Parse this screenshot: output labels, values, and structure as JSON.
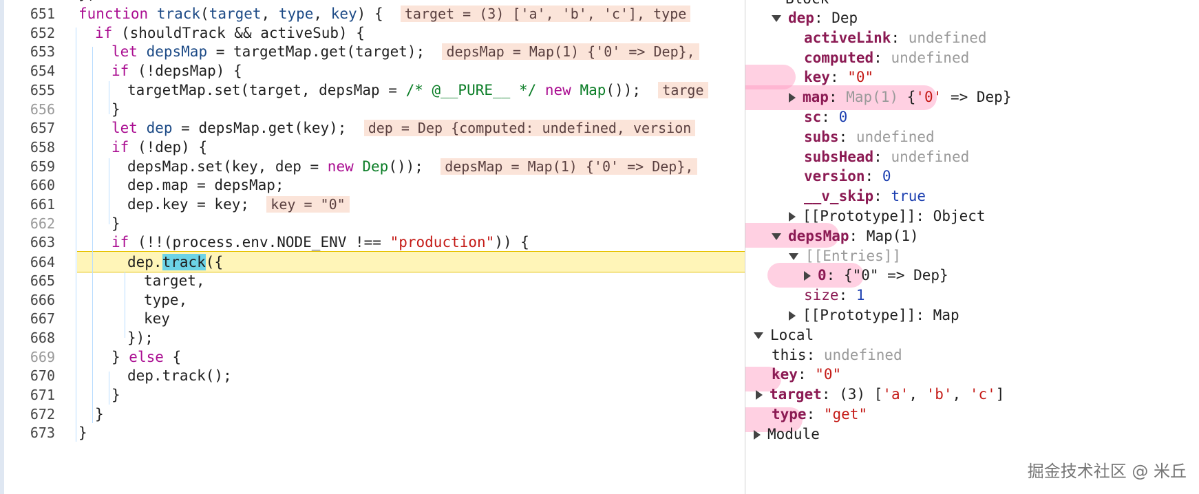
{
  "editor": {
    "partial_top_code": "};",
    "lines": [
      {
        "n": "651",
        "html": "<span class='kw'>function</span> <span class='fn'>track</span>(<span class='fn'>target</span>, <span class='fn'>type</span>, <span class='fn'>key</span>) {  <span class='inline-val'>target = (3) ['a', 'b', 'c'], type</span>",
        "indent": 114
      },
      {
        "n": "652",
        "html": "<span class='kw'>if</span> (shouldTrack && activeSub) {",
        "indent": 138
      },
      {
        "n": "653",
        "html": "<span class='kw'>let</span> <span class='fn'>depsMap</span> = targetMap.get(target);  <span class='inline-val'>depsMap = Map(1) {'0' => Dep},</span>",
        "indent": 162
      },
      {
        "n": "654",
        "html": "<span class='kw'>if</span> (!depsMap) {",
        "indent": 162
      },
      {
        "n": "655",
        "html": "targetMap.set(target, depsMap = <span class='cmt'>/* @__PURE__ */</span> <span class='kw'>new</span> <span class='cls'>Map</span>());  <span class='inline-val'>targe</span>",
        "indent": 185
      },
      {
        "n": "656",
        "html": "}",
        "indent": 162
      },
      {
        "n": "657",
        "html": "<span class='kw'>let</span> <span class='fn'>dep</span> = depsMap.get(key);  <span class='inline-val'>dep = Dep {computed: undefined, version</span>",
        "indent": 162
      },
      {
        "n": "658",
        "html": "<span class='kw'>if</span> (!dep) {",
        "indent": 162
      },
      {
        "n": "659",
        "html": "depsMap.set(key, dep = <span class='kw'>new</span> <span class='cls'>Dep</span>());  <span class='inline-val'>depsMap = Map(1) {'0' => Dep},</span>",
        "indent": 185
      },
      {
        "n": "660",
        "html": "dep.map = depsMap;",
        "indent": 185
      },
      {
        "n": "661",
        "html": "dep.key = key;  <span class='inline-val'>key = \"0\"</span>",
        "indent": 185
      },
      {
        "n": "662",
        "html": "}",
        "indent": 162
      },
      {
        "n": "663",
        "html": "<span class='kw'>if</span> (!!(process.env.NODE_ENV !== <span class='str'>\"production\"</span>)) {",
        "indent": 162
      },
      {
        "n": "664",
        "html": "dep.<span class='hl-track'>track</span>({",
        "indent": 185,
        "current": true
      },
      {
        "n": "665",
        "html": "target,",
        "indent": 209
      },
      {
        "n": "666",
        "html": "type,",
        "indent": 209
      },
      {
        "n": "667",
        "html": "key",
        "indent": 209
      },
      {
        "n": "668",
        "html": "});",
        "indent": 185
      },
      {
        "n": "669",
        "html": "} <span class='kw'>else</span> {",
        "indent": 162
      },
      {
        "n": "670",
        "html": "dep.track();",
        "indent": 185
      },
      {
        "n": "671",
        "html": "}",
        "indent": 162
      },
      {
        "n": "672",
        "html": "}",
        "indent": 138
      },
      {
        "n": "673",
        "html": "}",
        "indent": 114
      }
    ]
  },
  "scope": {
    "partial_top": "Block",
    "rows": [
      {
        "indent": 38,
        "tri": "down",
        "html": "<span class='pk'>dep</span>: <span class='plain'>Dep</span>"
      },
      {
        "indent": 85,
        "tri": "",
        "html": "<span class='pk'>activeLink</span>: <span class='und'>undefined</span>"
      },
      {
        "indent": 85,
        "tri": "",
        "html": "<span class='pk'>computed</span>: <span class='und'>undefined</span>"
      },
      {
        "indent": 85,
        "tri": "",
        "html": "<span class='pk'>key</span>: <span class='sstr'>\"0\"</span>",
        "mark": [
          1055,
          112,
          100
        ]
      },
      {
        "indent": 63,
        "tri": "right",
        "html": "<span class='pk'>map</span>: <span class='und'>Map(1)</span> {<span class='sstr'>'0'</span> => Dep}",
        "mark": [
          1030,
          142,
          330
        ]
      },
      {
        "indent": 85,
        "tri": "",
        "html": "<span class='pk'>sc</span>: <span class='num'>0</span>"
      },
      {
        "indent": 85,
        "tri": "",
        "html": "<span class='pk'>subs</span>: <span class='und'>undefined</span>"
      },
      {
        "indent": 85,
        "tri": "",
        "html": "<span class='pk'>subsHead</span>: <span class='und'>undefined</span>"
      },
      {
        "indent": 85,
        "tri": "",
        "html": "<span class='pk'>version</span>: <span class='num'>0</span>"
      },
      {
        "indent": 85,
        "tri": "",
        "html": "<span class='pk'>__v_skip</span>: <span class='bool'>true</span>"
      },
      {
        "indent": 63,
        "tri": "right",
        "html": "<span class='plain'>[[Prototype]]</span>: <span class='plain'>Object</span>"
      },
      {
        "indent": 38,
        "tri": "down",
        "html": "<span class='pk'>depsMap</span>: <span class='plain'>Map(1)</span>",
        "mark": [
          1000,
          342,
          218
        ]
      },
      {
        "indent": 63,
        "tri": "down",
        "html": "<span class='und'>[[Entries]]</span>"
      },
      {
        "indent": 85,
        "tri": "right",
        "html": "<span class='pk'>0</span>: <span class='plain'>{\"0\" => Dep}</span>",
        "mark": [
          1114,
          400,
          140
        ]
      },
      {
        "indent": 85,
        "tri": "",
        "html": "<span class='pkn'>size</span>: <span class='num'>1</span>"
      },
      {
        "indent": 63,
        "tri": "right",
        "html": "<span class='plain'>[[Prototype]]</span>: <span class='plain'>Map</span>"
      },
      {
        "indent": 12,
        "tri": "down",
        "html": "<span class='plain'>Local</span>"
      },
      {
        "indent": 38,
        "tri": "",
        "html": "<span class='plain'>this</span>: <span class='und'>undefined</span>"
      },
      {
        "indent": 38,
        "tri": "",
        "html": "<span class='pk'>key</span>: <span class='sstr'>\"0\"</span>",
        "mark": [
          1022,
          551,
          112
        ]
      },
      {
        "indent": 15,
        "tri": "right",
        "html": "<span class='pk'>target</span>: <span class='plain'>(3) [</span><span class='sstr'>'a'</span>, <span class='sstr'>'b'</span>, <span class='sstr'>'c'</span>]"
      },
      {
        "indent": 38,
        "tri": "",
        "html": "<span class='pk'>type</span>: <span class='sstr'>\"get\"</span>",
        "mark": [
          1015,
          610,
          150
        ]
      },
      {
        "indent": 12,
        "tri": "right",
        "html": "<span class='plain'>Module</span>"
      }
    ]
  },
  "watermark": "掘金技术社区 @ 米丘"
}
